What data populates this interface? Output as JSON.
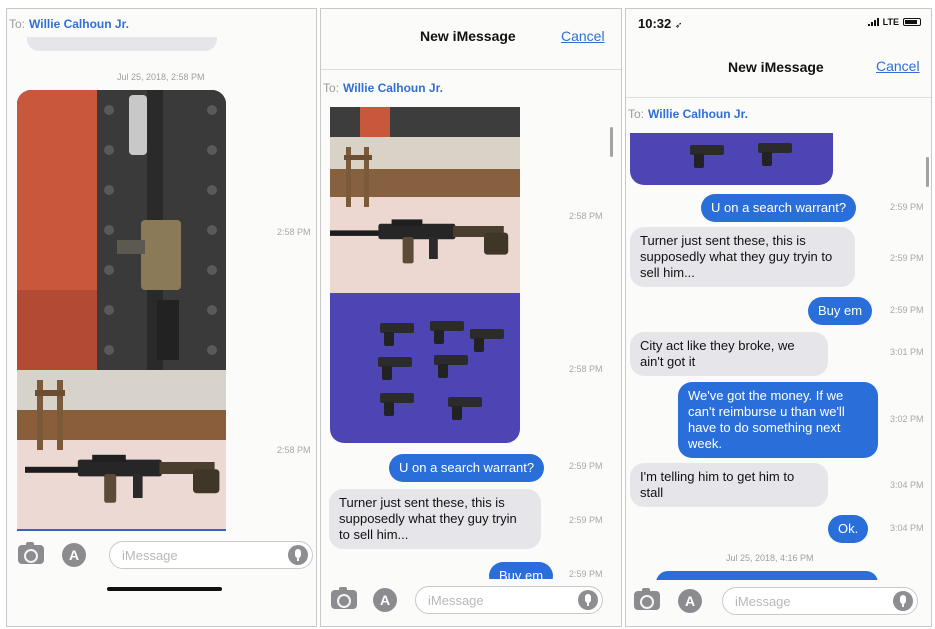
{
  "colors": {
    "imessage_blue": "#2a6fd9",
    "link_blue": "#2f6fd6",
    "incoming_gray": "#e6e5ea"
  },
  "panel1": {
    "to_label": "To:",
    "recipient": "Willie Calhoun Jr.",
    "date_separator": "Jul 25, 2018, 2:58 PM",
    "photos": [
      {
        "icon": "rifle-in-case-photo",
        "time": "2:58 PM"
      },
      {
        "icon": "rifle-on-bed-photo",
        "time": "2:58 PM"
      }
    ],
    "compose": {
      "camera_icon": "camera-icon",
      "apps_icon": "app-store-icon",
      "apps_glyph": "A",
      "placeholder": "iMessage",
      "mic_icon": "mic-icon"
    }
  },
  "panel2": {
    "title": "New iMessage",
    "cancel": "Cancel",
    "to_label": "To:",
    "recipient": "Willie Calhoun Jr.",
    "photos": [
      {
        "icon": "rifle-on-bed-photo",
        "time": "2:58 PM"
      },
      {
        "icon": "handguns-photo",
        "time": "2:58 PM"
      }
    ],
    "messages": [
      {
        "direction": "out",
        "text": "U on a search warrant?",
        "time": "2:59 PM"
      },
      {
        "direction": "in",
        "text": "Turner just sent these, this is supposedly what they guy tryin to sell him...",
        "time": "2:59 PM"
      },
      {
        "direction": "out",
        "text": "Buy em",
        "time": "2:59 PM"
      }
    ],
    "compose": {
      "placeholder": "iMessage",
      "apps_glyph": "A"
    }
  },
  "panel3": {
    "status": {
      "time": "10:32",
      "location_glyph": "➶",
      "network": "LTE"
    },
    "title": "New iMessage",
    "cancel": "Cancel",
    "to_label": "To:",
    "recipient": "Willie Calhoun Jr.",
    "photos": [
      {
        "icon": "handguns-photo"
      }
    ],
    "messages": [
      {
        "direction": "out",
        "text": "U on a search warrant?",
        "time": "2:59 PM"
      },
      {
        "direction": "in",
        "text": "Turner just sent these, this is supposedly what they guy tryin to sell him...",
        "time": "2:59 PM"
      },
      {
        "direction": "out",
        "text": "Buy em",
        "time": "2:59 PM"
      },
      {
        "direction": "in",
        "text": "City act like they broke, we ain't got it",
        "time": "3:01 PM"
      },
      {
        "direction": "out",
        "text": "We've got the money.  If we can't reimburse u than we'll have to do something next week.",
        "time": "3:02 PM"
      },
      {
        "direction": "in",
        "text": "I'm telling him to get him to stall",
        "time": "3:04 PM"
      },
      {
        "direction": "out",
        "text": "Ok.",
        "time": "3:04 PM"
      }
    ],
    "date_separator": "Jul 25, 2018, 4:16 PM",
    "compose": {
      "placeholder": "iMessage",
      "apps_glyph": "A"
    }
  }
}
